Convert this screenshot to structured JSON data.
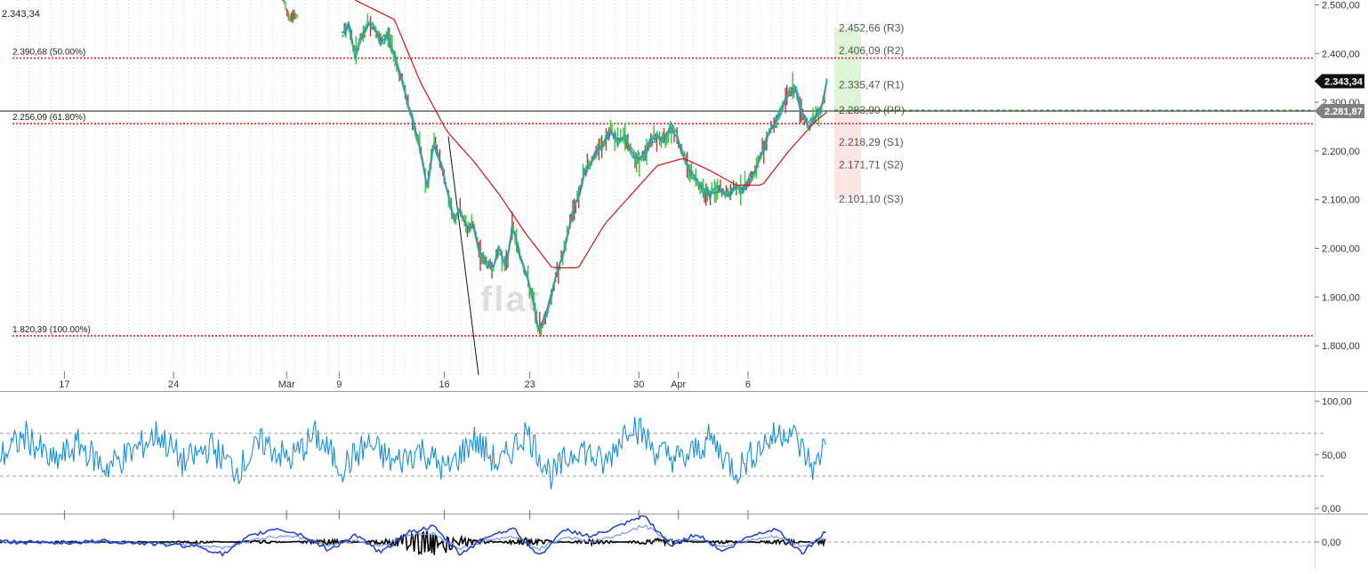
{
  "chart_data": [
    {
      "type": "line",
      "panel": "price",
      "title": "",
      "corner_label": "2.343,34",
      "ylim": [
        1740,
        2510
      ],
      "y_ticks": [
        1800,
        1900,
        2000,
        2100,
        2200,
        2300,
        2400,
        2500
      ],
      "y_tick_labels": [
        "1.800,00",
        "1.900,00",
        "2.000,00",
        "2.100,00",
        "2.200,00",
        "2.300,00",
        "2.400,00",
        "2.500,00"
      ],
      "x_tick_labels": [
        "17",
        "24",
        "Mär",
        "9",
        "16",
        "23",
        "30",
        "Apr",
        "6"
      ],
      "x_tick_positions": [
        0.049,
        0.132,
        0.218,
        0.258,
        0.338,
        0.403,
        0.486,
        0.516,
        0.569
      ],
      "last_price": 2343.34,
      "last_price_label": "2.343,34",
      "reference_price": 2281.87,
      "reference_price_label": "2.281,87",
      "fib_levels": [
        {
          "label": "2.390,68 (50.00%)",
          "value": 2390.68
        },
        {
          "label": "2.256,09 (61.80%)",
          "value": 2256.09
        },
        {
          "label": "1.820,39 (100.00%)",
          "value": 1820.39
        }
      ],
      "pivot_levels": [
        {
          "label": "2.452,66 (R3)",
          "value": 2452.66
        },
        {
          "label": "2.406,09 (R2)",
          "value": 2406.09
        },
        {
          "label": "2.335,47 (R1)",
          "value": 2335.47
        },
        {
          "label": "2.283,90 (PP)",
          "value": 2283.9
        },
        {
          "label": "2.218,29 (S1)",
          "value": 2218.29
        },
        {
          "label": "2.171,71 (S2)",
          "value": 2171.71
        },
        {
          "label": "2.101,10 (S3)",
          "value": 2101.1
        }
      ],
      "watermark": "flat",
      "series": [
        {
          "x": [
            0.215,
            0.22,
            0.26,
            0.265,
            0.27,
            0.275,
            0.28,
            0.285,
            0.29,
            0.295,
            0.3,
            0.305,
            0.31,
            0.315,
            0.32,
            0.325,
            0.33,
            0.335,
            0.34,
            0.345,
            0.35,
            0.355,
            0.36,
            0.365,
            0.37,
            0.375,
            0.38,
            0.385,
            0.39,
            0.395,
            0.4,
            0.405,
            0.41,
            0.415,
            0.42,
            0.425,
            0.43,
            0.435,
            0.44,
            0.445,
            0.45,
            0.455,
            0.46,
            0.465,
            0.47,
            0.475,
            0.48,
            0.485,
            0.49,
            0.495,
            0.5,
            0.505,
            0.51,
            0.515,
            0.52,
            0.525,
            0.53,
            0.535,
            0.54,
            0.545,
            0.55,
            0.555,
            0.56,
            0.565,
            0.57,
            0.575,
            0.58,
            0.585,
            0.59,
            0.595,
            0.6,
            0.605,
            0.61,
            0.615,
            0.62,
            0.625,
            0.629
          ],
          "y": [
            2510,
            2480,
            2440,
            2460,
            2400,
            2430,
            2460,
            2450,
            2420,
            2440,
            2400,
            2350,
            2300,
            2250,
            2200,
            2120,
            2220,
            2180,
            2120,
            2060,
            2080,
            2040,
            2050,
            1990,
            1970,
            1960,
            2000,
            1960,
            2050,
            1990,
            1950,
            1900,
            1830,
            1860,
            1910,
            1960,
            2000,
            2070,
            2110,
            2160,
            2180,
            2200,
            2220,
            2240,
            2220,
            2230,
            2200,
            2180,
            2190,
            2220,
            2230,
            2220,
            2250,
            2230,
            2190,
            2160,
            2140,
            2120,
            2110,
            2120,
            2115,
            2110,
            2130,
            2120,
            2140,
            2160,
            2200,
            2240,
            2260,
            2290,
            2320,
            2330,
            2280,
            2250,
            2270,
            2290,
            2343
          ]
        },
        {
          "x": [
            0.27,
            0.3,
            0.32,
            0.34,
            0.36,
            0.38,
            0.4,
            0.42,
            0.44,
            0.46,
            0.48,
            0.5,
            0.52,
            0.54,
            0.56,
            0.58,
            0.6,
            0.62,
            0.629
          ],
          "y": [
            2510,
            2470,
            2340,
            2240,
            2180,
            2110,
            2030,
            1960,
            1960,
            2050,
            2110,
            2170,
            2185,
            2160,
            2130,
            2130,
            2200,
            2260,
            2280
          ]
        }
      ]
    },
    {
      "type": "line",
      "panel": "oscillator",
      "ylim": [
        -5,
        108
      ],
      "y_ticks": [
        0,
        50,
        100
      ],
      "y_tick_labels": [
        "0,00",
        "50,00",
        "100,00"
      ],
      "reference_lines": [
        30,
        70
      ],
      "series": [
        {
          "x": [
            0.0,
            0.02,
            0.04,
            0.06,
            0.08,
            0.1,
            0.12,
            0.14,
            0.16,
            0.18,
            0.2,
            0.22,
            0.24,
            0.26,
            0.28,
            0.3,
            0.32,
            0.34,
            0.36,
            0.38,
            0.4,
            0.42,
            0.44,
            0.46,
            0.48,
            0.5,
            0.52,
            0.54,
            0.56,
            0.58,
            0.6,
            0.62,
            0.629
          ],
          "y": [
            48,
            68,
            42,
            60,
            38,
            52,
            70,
            42,
            58,
            35,
            62,
            45,
            68,
            38,
            60,
            42,
            55,
            35,
            65,
            40,
            72,
            30,
            58,
            40,
            82,
            52,
            45,
            65,
            35,
            60,
            75,
            35,
            70
          ]
        }
      ]
    },
    {
      "type": "line",
      "panel": "macd",
      "ylim": [
        -1,
        1
      ],
      "y_ticks": [
        0
      ],
      "y_tick_labels": [
        "0,00"
      ],
      "series": [
        {
          "x": [
            0.0,
            0.04,
            0.08,
            0.12,
            0.15,
            0.17,
            0.19,
            0.21,
            0.23,
            0.25,
            0.27,
            0.29,
            0.31,
            0.33,
            0.35,
            0.37,
            0.39,
            0.41,
            0.43,
            0.45,
            0.47,
            0.49,
            0.51,
            0.53,
            0.55,
            0.57,
            0.59,
            0.61,
            0.629
          ],
          "y": [
            0.02,
            -0.04,
            0.03,
            -0.08,
            -0.15,
            -0.45,
            0.2,
            0.5,
            0.25,
            -0.3,
            0.25,
            -0.4,
            0.35,
            0.55,
            -0.45,
            0.2,
            0.5,
            -0.5,
            0.45,
            0.2,
            0.55,
            0.95,
            -0.15,
            0.3,
            -0.35,
            0.2,
            0.5,
            -0.4,
            0.4
          ]
        },
        {
          "x": [
            0.0,
            0.04,
            0.08,
            0.12,
            0.15,
            0.17,
            0.19,
            0.21,
            0.23,
            0.25,
            0.27,
            0.29,
            0.31,
            0.33,
            0.35,
            0.37,
            0.39,
            0.41,
            0.43,
            0.45,
            0.47,
            0.49,
            0.51,
            0.53,
            0.55,
            0.57,
            0.59,
            0.61,
            0.629
          ],
          "y": [
            0.0,
            -0.02,
            0.02,
            -0.05,
            -0.1,
            -0.2,
            0.05,
            0.2,
            0.15,
            -0.1,
            0.05,
            -0.15,
            0.25,
            0.3,
            -0.25,
            0.05,
            0.2,
            -0.25,
            0.2,
            0.0,
            0.25,
            0.6,
            0.05,
            0.1,
            -0.15,
            0.05,
            0.2,
            -0.15,
            0.15
          ]
        },
        {
          "x": [
            0.0,
            0.05,
            0.1,
            0.15,
            0.2,
            0.25,
            0.3,
            0.33,
            0.34,
            0.35,
            0.4,
            0.45,
            0.5,
            0.55,
            0.6,
            0.629
          ],
          "y": [
            0.02,
            -0.03,
            0.02,
            -0.04,
            0.05,
            -0.08,
            0.1,
            0.5,
            -0.4,
            0.15,
            -0.12,
            0.08,
            -0.1,
            0.05,
            -0.08,
            0.1
          ]
        }
      ]
    }
  ],
  "colors": {
    "fib_line": "#e8201e",
    "pivot_zone_up": "#d7f2cf",
    "pivot_zone_down": "#fbe1e1",
    "candles_up": "#3cbf3c",
    "candles_down": "#b03a3a",
    "ma_fast": "#22c97a",
    "ma_slow": "#c81414",
    "oscillator": "#1c8ed2",
    "macd": "#1f3fc9",
    "signal": "#000000",
    "reference_line": "#1a1a1a",
    "pp_dash": "#39b539",
    "last_badge": "#111111",
    "reference_badge": "#808080"
  }
}
